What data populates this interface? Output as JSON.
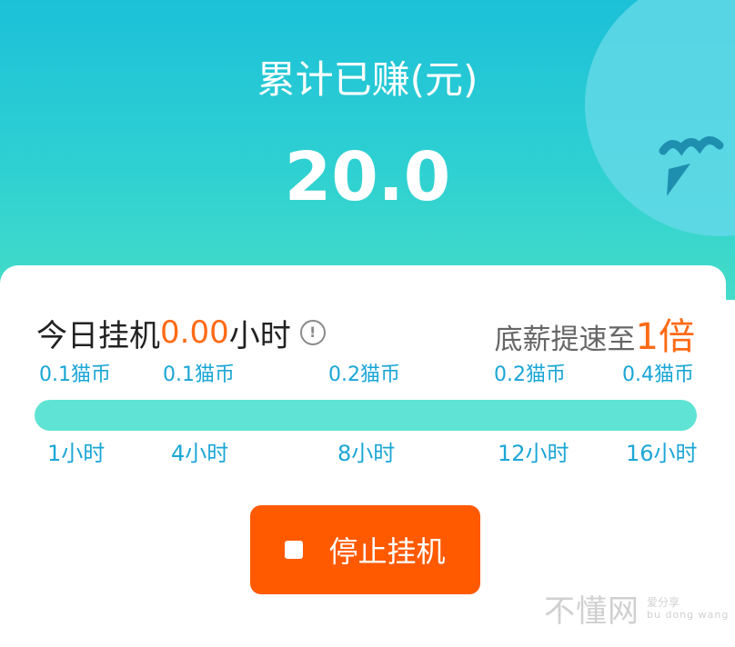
{
  "header": {
    "earned_label": "累计已赚(元)",
    "earned_value": "20.0",
    "gradient_top": "#1cc0d8",
    "gradient_bottom": "#44dcc8",
    "decoration_icon": "fish-icon"
  },
  "card": {
    "today_prefix": "今日挂机",
    "today_hours": "0.00",
    "today_suffix": "小时",
    "info_icon": "info-icon",
    "speed_prefix": "底薪提速至",
    "speed_multiplier": "1倍",
    "progress": 0,
    "coins": [
      "0.1猫币",
      "0.1猫币",
      "0.2猫币",
      "0.2猫币",
      "0.4猫币"
    ],
    "hours": [
      "1小时",
      "4小时",
      "8小时",
      "12小时",
      "16小时"
    ]
  },
  "action": {
    "stop_label": "停止挂机",
    "stop_icon": "stop-icon",
    "color": "#ff5a00"
  },
  "watermark": {
    "main": "不懂网",
    "small": "爱分享",
    "tiny": "bu dong wang"
  },
  "colors": {
    "accent_orange": "#ff6a14",
    "track_teal": "#5fe3d4",
    "label_blue": "#1aa6d6"
  }
}
